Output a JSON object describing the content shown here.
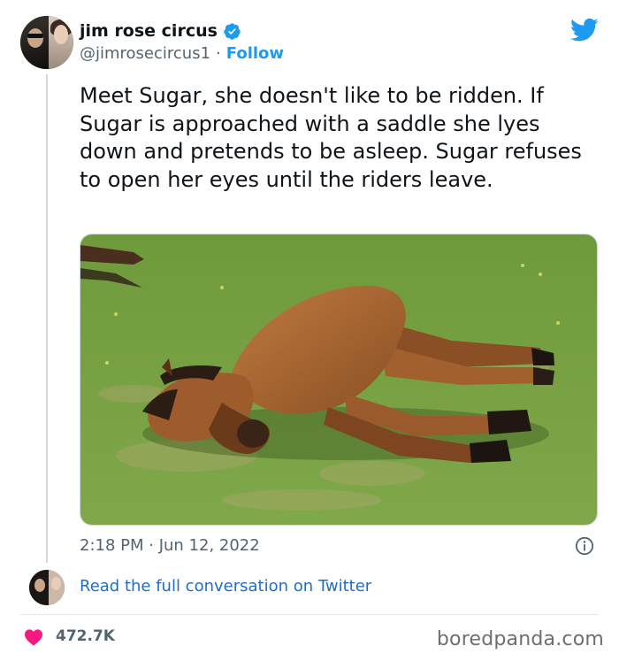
{
  "author": {
    "display_name": "jim rose circus",
    "handle": "@jimrosecircus1",
    "separator": "·",
    "follow_label": "Follow"
  },
  "tweet": {
    "text": "Meet Sugar, she doesn't like to be ridden. If Sugar is approached with a saddle she lyes down and pretends to be asleep. Sugar refuses to open her eyes until the riders leave.",
    "timestamp": "2:18 PM · Jun 12, 2022"
  },
  "conversation": {
    "link_label": "Read the full conversation on Twitter"
  },
  "footer": {
    "likes": "472.7K",
    "watermark": "boredpanda.com"
  },
  "icons": {
    "verified": "verified-badge-icon",
    "twitter": "twitter-bird-icon",
    "info": "info-icon",
    "like": "heart-icon"
  },
  "colors": {
    "twitter_blue": "#1d9bf0",
    "link_blue": "#1d6ec9",
    "heart_pink": "#f91880",
    "muted_text": "#536471"
  }
}
